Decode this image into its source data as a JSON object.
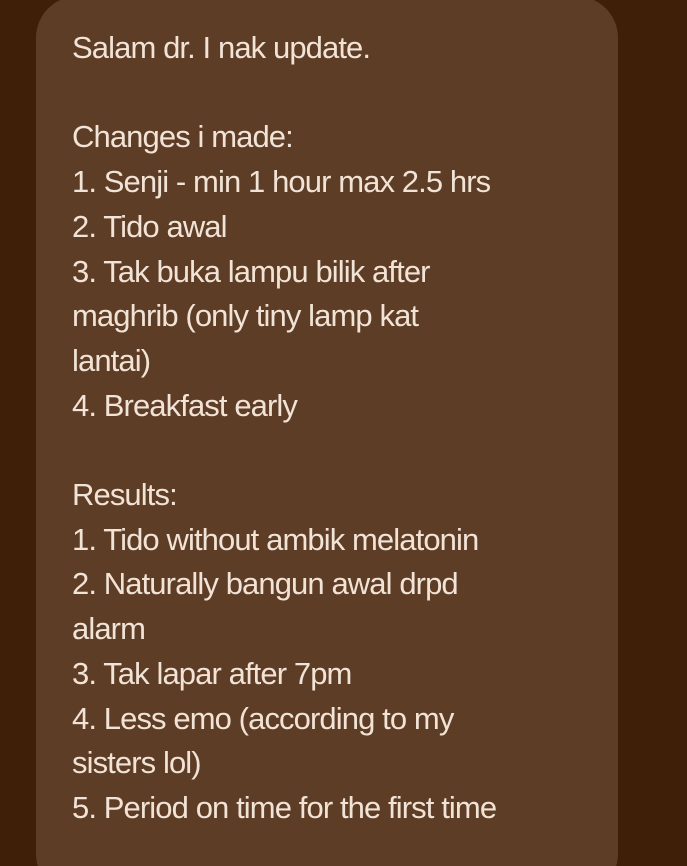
{
  "chat": {
    "message": {
      "lines": [
        "Salam dr. I nak update.",
        "",
        "Changes i made:",
        "1. Senji - min 1 hour max 2.5 hrs",
        "2. Tido awal",
        "3. Tak buka lampu bilik after",
        "maghrib (only tiny lamp kat",
        "lantai)",
        "4. Breakfast early",
        "",
        "Results:",
        "1. Tido without ambik melatonin",
        "2. Naturally bangun awal drpd",
        "alarm",
        "3. Tak lapar after 7pm",
        "4. Less emo (according to my",
        "sisters lol)",
        "5. Period on time for the first time"
      ]
    }
  },
  "colors": {
    "background": "#3f1f08",
    "bubble": "#5e3d27",
    "text": "#f1e3d6"
  }
}
